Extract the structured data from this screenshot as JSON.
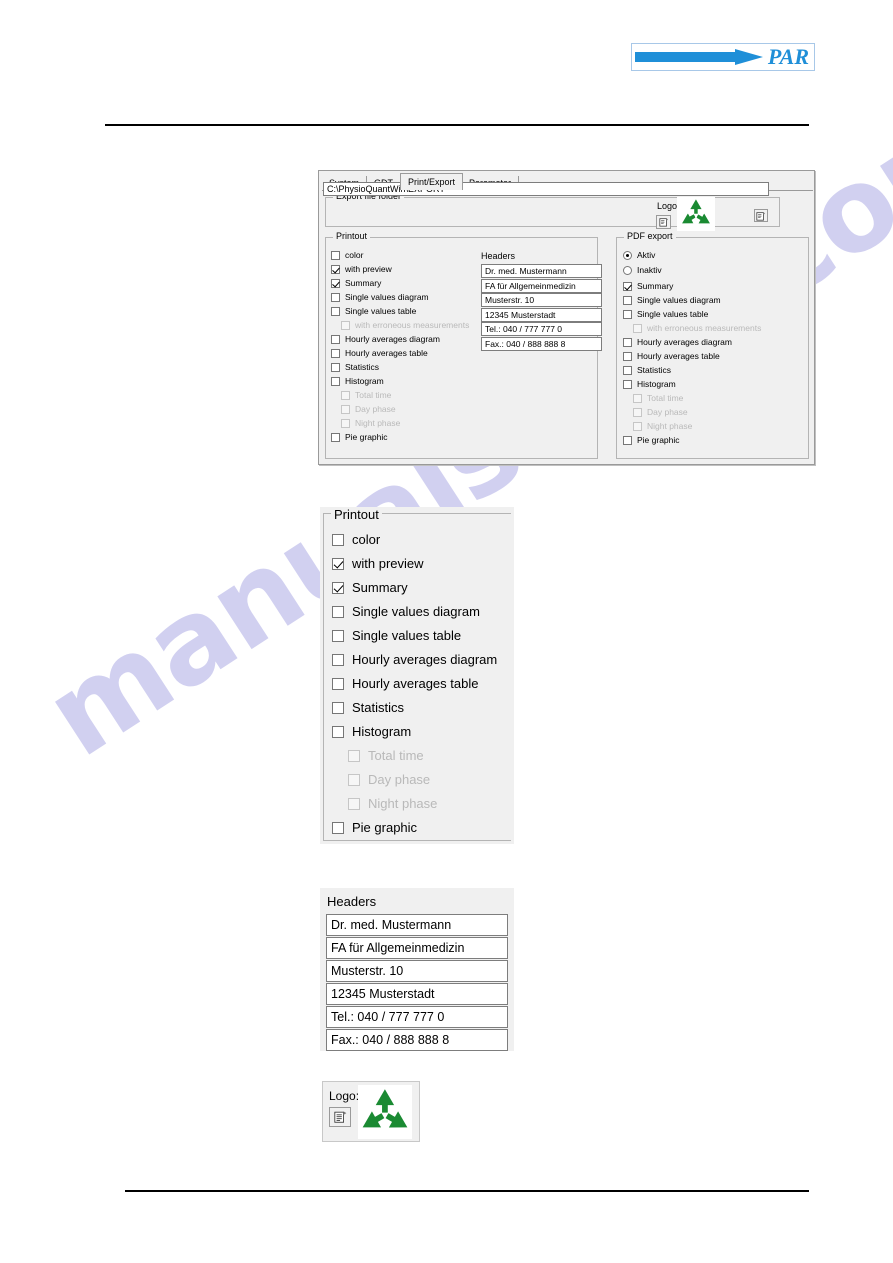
{
  "brand": {
    "logo_text": "PAR",
    "logo_icon": "blue-arrow-icon",
    "accent_color": "#1f8fd8"
  },
  "colors": {
    "dialog_bg": "#f0f0f0",
    "recycle_green": "#1a8a32",
    "watermark": "#c9c8ee",
    "field_bg": "#ffffff"
  },
  "watermark": {
    "text": "manualshive.com"
  },
  "dialog": {
    "tabs": [
      {
        "label": "System",
        "active": false
      },
      {
        "label": "GDT",
        "active": false
      },
      {
        "label": "Print/Export",
        "active": true
      },
      {
        "label": "Parameter",
        "active": false
      }
    ],
    "export_folder": {
      "group_title": "Export file folder",
      "value": "C:\\PhysioQuantWin\\EXPORT",
      "browse_icon": "browse-folder-icon"
    },
    "logo": {
      "label": "Logo:",
      "browse_icon": "browse-file-icon",
      "image": "recycle-symbol-icon"
    },
    "printout": {
      "group_title": "Printout",
      "items": [
        {
          "label": "color",
          "checked": false,
          "disabled": false,
          "sub": false
        },
        {
          "label": "with preview",
          "checked": true,
          "disabled": false,
          "sub": false
        },
        {
          "label": "Summary",
          "checked": true,
          "disabled": false,
          "sub": false
        },
        {
          "label": "Single values diagram",
          "checked": false,
          "disabled": false,
          "sub": false
        },
        {
          "label": "Single values table",
          "checked": false,
          "disabled": false,
          "sub": false
        },
        {
          "label": "with erroneous measurements",
          "checked": false,
          "disabled": true,
          "sub": true
        },
        {
          "label": "Hourly averages diagram",
          "checked": false,
          "disabled": false,
          "sub": false
        },
        {
          "label": "Hourly averages table",
          "checked": false,
          "disabled": false,
          "sub": false
        },
        {
          "label": "Statistics",
          "checked": false,
          "disabled": false,
          "sub": false
        },
        {
          "label": "Histogram",
          "checked": false,
          "disabled": false,
          "sub": false
        },
        {
          "label": "Total time",
          "checked": false,
          "disabled": true,
          "sub": true
        },
        {
          "label": "Day phase",
          "checked": false,
          "disabled": true,
          "sub": true
        },
        {
          "label": "Night phase",
          "checked": false,
          "disabled": true,
          "sub": true
        },
        {
          "label": "Pie graphic",
          "checked": false,
          "disabled": false,
          "sub": false
        }
      ]
    },
    "headers": {
      "label": "Headers",
      "lines": [
        "Dr. med. Mustermann",
        "FA für Allgemeinmedizin",
        "Musterstr. 10",
        "12345 Musterstadt",
        "Tel.: 040 / 777 777 0",
        "Fax.: 040 / 888 888 8"
      ]
    },
    "pdf_export": {
      "group_title": "PDF export",
      "radios": [
        {
          "label": "Aktiv",
          "selected": true
        },
        {
          "label": "Inaktiv",
          "selected": false
        }
      ],
      "items": [
        {
          "label": "Summary",
          "checked": true,
          "disabled": false,
          "sub": false
        },
        {
          "label": "Single values diagram",
          "checked": false,
          "disabled": false,
          "sub": false
        },
        {
          "label": "Single values table",
          "checked": false,
          "disabled": false,
          "sub": false
        },
        {
          "label": "with erroneous measurements",
          "checked": false,
          "disabled": true,
          "sub": true
        },
        {
          "label": "Hourly averages diagram",
          "checked": false,
          "disabled": false,
          "sub": false
        },
        {
          "label": "Hourly averages table",
          "checked": false,
          "disabled": false,
          "sub": false
        },
        {
          "label": "Statistics",
          "checked": false,
          "disabled": false,
          "sub": false
        },
        {
          "label": "Histogram",
          "checked": false,
          "disabled": false,
          "sub": false
        },
        {
          "label": "Total time",
          "checked": false,
          "disabled": true,
          "sub": true
        },
        {
          "label": "Day phase",
          "checked": false,
          "disabled": true,
          "sub": true
        },
        {
          "label": "Night phase",
          "checked": false,
          "disabled": true,
          "sub": true
        },
        {
          "label": "Pie graphic",
          "checked": false,
          "disabled": false,
          "sub": false
        }
      ]
    }
  },
  "detail_printout": {
    "group_title": "Printout",
    "items": [
      {
        "label": "color",
        "checked": false,
        "disabled": false,
        "sub": false
      },
      {
        "label": "with preview",
        "checked": true,
        "disabled": false,
        "sub": false
      },
      {
        "label": "Summary",
        "checked": true,
        "disabled": false,
        "sub": false
      },
      {
        "label": "Single values diagram",
        "checked": false,
        "disabled": false,
        "sub": false
      },
      {
        "label": "Single values table",
        "checked": false,
        "disabled": false,
        "sub": false
      },
      {
        "label": "Hourly averages diagram",
        "checked": false,
        "disabled": false,
        "sub": false
      },
      {
        "label": "Hourly averages table",
        "checked": false,
        "disabled": false,
        "sub": false
      },
      {
        "label": "Statistics",
        "checked": false,
        "disabled": false,
        "sub": false
      },
      {
        "label": "Histogram",
        "checked": false,
        "disabled": false,
        "sub": false
      },
      {
        "label": "Total time",
        "checked": false,
        "disabled": true,
        "sub": true
      },
      {
        "label": "Day phase",
        "checked": false,
        "disabled": true,
        "sub": true
      },
      {
        "label": "Night phase",
        "checked": false,
        "disabled": true,
        "sub": true
      },
      {
        "label": "Pie graphic",
        "checked": false,
        "disabled": false,
        "sub": false
      }
    ]
  },
  "detail_headers": {
    "label": "Headers",
    "lines": [
      "Dr. med. Mustermann",
      "FA für Allgemeinmedizin",
      "Musterstr. 10",
      "12345 Musterstadt",
      "Tel.: 040 / 777 777 0",
      "Fax.: 040 / 888 888 8"
    ]
  },
  "detail_logo": {
    "label": "Logo:",
    "browse_icon": "browse-file-icon",
    "image": "recycle-symbol-icon"
  }
}
